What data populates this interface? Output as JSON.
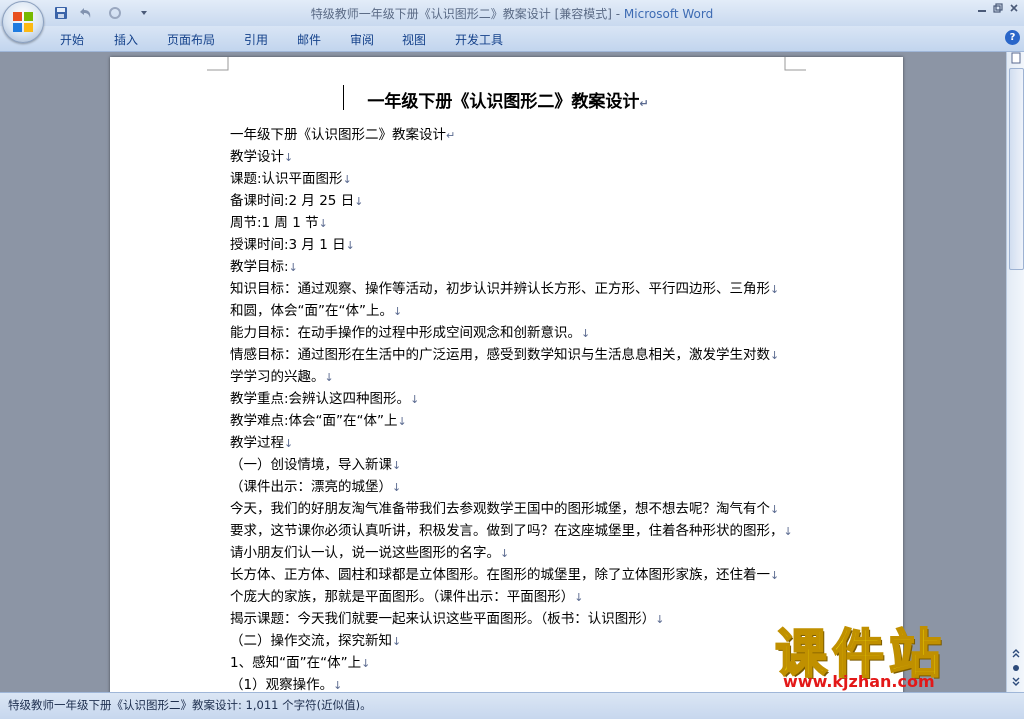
{
  "window": {
    "title": "特级教师一年级下册《认识图形二》教案设计 [兼容模式] - ",
    "app_name": "Microsoft Word"
  },
  "quick_access": {
    "save_icon": "save-icon",
    "undo_icon": "undo-icon",
    "redo_icon": "redo-icon",
    "customize_icon": "dropdown-icon"
  },
  "ribbon": {
    "tabs": [
      {
        "label": "开始"
      },
      {
        "label": "插入"
      },
      {
        "label": "页面布局"
      },
      {
        "label": "引用"
      },
      {
        "label": "邮件"
      },
      {
        "label": "审阅"
      },
      {
        "label": "视图"
      },
      {
        "label": "开发工具"
      }
    ],
    "help_label": "?"
  },
  "document": {
    "heading": "一年级下册《认识图形二》教案设计",
    "lines": [
      "一年级下册《认识图形二》教案设计",
      "教学设计",
      "课题:认识平面图形",
      "备课时间:2 月 25 日",
      "周节:1 周 1 节",
      "授课时间:3 月 1 日",
      "教学目标:",
      "知识目标：通过观察、操作等活动，初步认识并辨认长方形、正方形、平行四边形、三角形",
      "和圆，体会“面”在“体”上。",
      "能力目标：在动手操作的过程中形成空间观念和创新意识。",
      "情感目标：通过图形在生活中的广泛运用，感受到数学知识与生活息息相关，激发学生对数",
      "学学习的兴趣。",
      "教学重点:会辨认这四种图形。",
      "教学难点:体会“面”在“体”上",
      "教学过程",
      "（一）创设情境，导入新课",
      "（课件出示：漂亮的城堡）",
      "今天，我们的好朋友淘气准备带我们去参观数学王国中的图形城堡，想不想去呢？淘气有个",
      "要求，这节课你必须认真听讲，积极发言。做到了吗？在这座城堡里，住着各种形状的图形，",
      "请小朋友们认一认，说一说这些图形的名字。",
      "长方体、正方体、圆柱和球都是立体图形。在图形的城堡里，除了立体图形家族，还住着一",
      "个庞大的家族，那就是平面图形。（课件出示：平面图形）",
      "揭示课题：今天我们就要一起来认识这些平面图形。（板书：认识图形）",
      "（二）操作交流，探究新知",
      "1、感知“面”在“体”上",
      "（1）观察操作。"
    ]
  },
  "status_bar": {
    "text": "特级教师一年级下册《认识图形二》教案设计: 1,011 个字符(近似值)。"
  },
  "watermark": {
    "logo_text": "课件站",
    "url": "www.kjzhan.com"
  },
  "colors": {
    "app_name": "#3d6bb3",
    "tab_text": "#15428b",
    "watermark_logo": "#f5e400",
    "watermark_url": "#e31818"
  }
}
